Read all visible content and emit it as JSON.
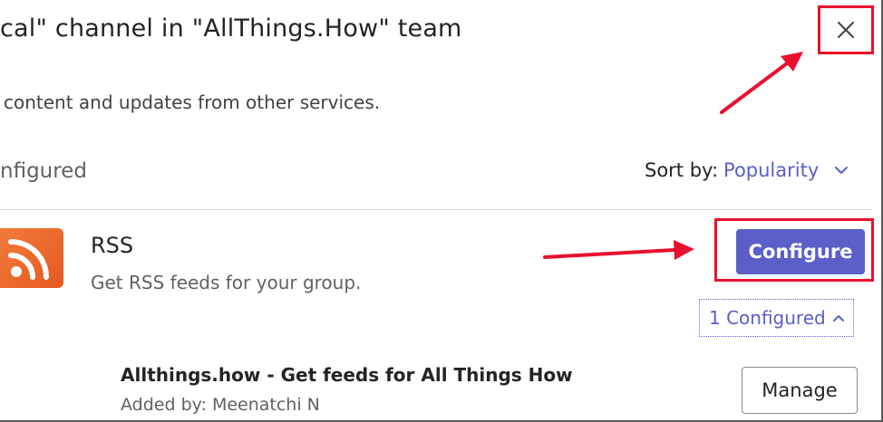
{
  "dialog": {
    "title": "cal\" channel in \"AllThings.How\" team",
    "subtitle": "content and updates from other services.",
    "close_icon": "close-icon"
  },
  "list": {
    "section_title": "nfigured",
    "sort_label": "Sort by:",
    "sort_value": "Popularity",
    "sort_icon": "chevron-down-icon"
  },
  "app": {
    "name": "RSS",
    "description": "Get RSS feeds for your group.",
    "icon": "rss-icon",
    "icon_color": "#e96328",
    "configure_label": "Configure",
    "configured_toggle": "1 Configured",
    "toggle_icon": "chevron-up-icon"
  },
  "configured_items": [
    {
      "name": "Allthings.how - Get feeds for All Things How",
      "added_by": "Added by: Meenatchi N",
      "manage_label": "Manage"
    }
  ],
  "colors": {
    "accent": "#5b5fc7",
    "annotation": "#e8112d"
  }
}
